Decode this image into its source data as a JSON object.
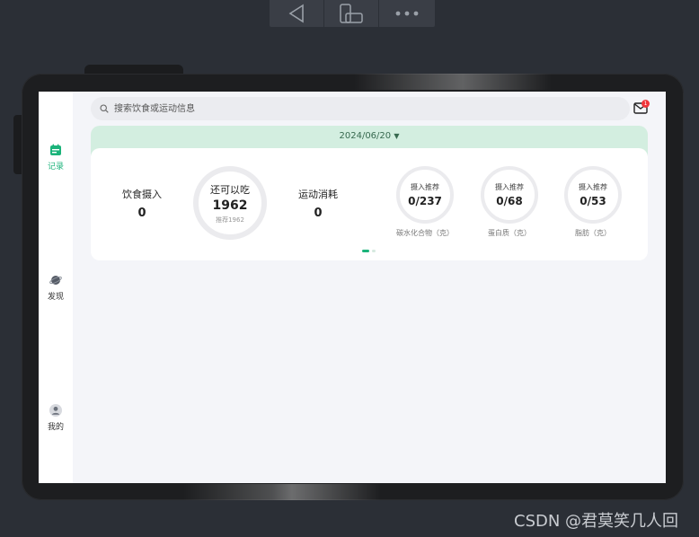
{
  "app": {
    "search": {
      "placeholder": "搜索饮食或运动信息"
    },
    "mail": {
      "badge": "1"
    },
    "nav": [
      {
        "label": "记录",
        "icon": "calendar-icon",
        "active": true
      },
      {
        "label": "发现",
        "icon": "planet-icon",
        "active": false
      },
      {
        "label": "我的",
        "icon": "user-icon",
        "active": false
      }
    ],
    "card": {
      "date": "2024/06/20",
      "intake": {
        "label": "饮食摄入",
        "value": "0"
      },
      "remaining": {
        "label": "还可以吃",
        "value": "1962",
        "sub": "推荐1962"
      },
      "exercise": {
        "label": "运动消耗",
        "value": "0"
      },
      "nutrients": [
        {
          "title": "摄入推荐",
          "value": "0/237",
          "caption": "碳水化合物（克）"
        },
        {
          "title": "摄入推荐",
          "value": "0/68",
          "caption": "蛋白质（克）"
        },
        {
          "title": "摄入推荐",
          "value": "0/53",
          "caption": "脂肪（克）"
        }
      ]
    },
    "colors": {
      "accent": "#1bb37a",
      "date_band": "#d3eee0",
      "badge": "#f0353b"
    }
  },
  "watermark": "CSDN @君莫笑几人回"
}
